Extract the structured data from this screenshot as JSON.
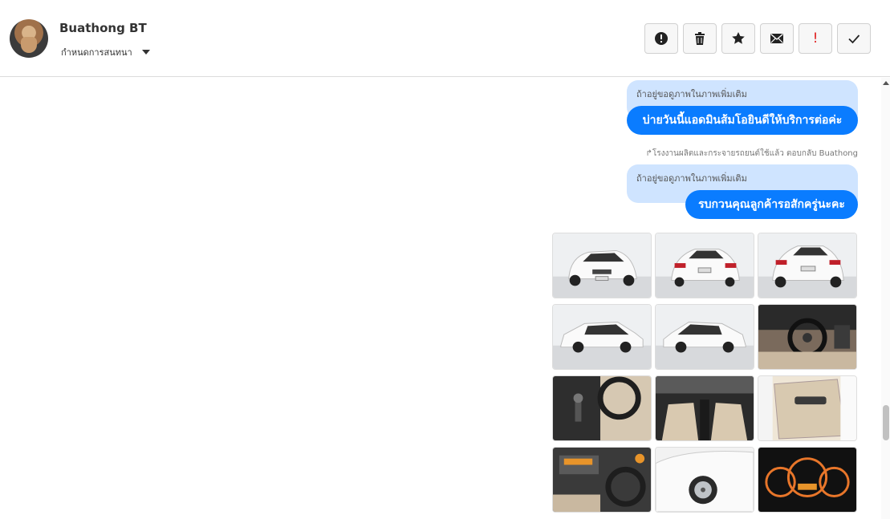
{
  "header": {
    "contact_name": "Buathong BT",
    "conversation_setting": "กำหนดการสนทนา"
  },
  "toolbar": {
    "buttons": [
      {
        "icon": "alert-circle-icon"
      },
      {
        "icon": "trash-icon"
      },
      {
        "icon": "star-icon"
      },
      {
        "icon": "envelope-icon"
      },
      {
        "icon": "exclamation-icon",
        "label": "!",
        "color": "#e02020"
      },
      {
        "icon": "check-icon"
      }
    ]
  },
  "messages": [
    {
      "quoted": "ถ้าอยู่ขอดูภาพในภาพเพิ่มเติม",
      "text": "บ่ายวันนี้แอดมินส้มโอยินดีให้บริการต่อค่ะ"
    },
    {
      "reply_meta": "↱โรงงานผลิตและกระจายรถยนต์ใช้แล้ว ตอบกลับ Buathong",
      "quoted": "ถ้าอยู่ขอดูภาพในภาพเพิ่มเติม",
      "text": "รบกวนคุณลูกค้ารอสักครู่นะคะ"
    }
  ],
  "colors": {
    "bubble": "#0a7cff",
    "quote": "#cfe4ff"
  },
  "photos": [
    "car-front-photo",
    "car-rear-photo",
    "car-rear-angle-photo",
    "car-side-left-photo",
    "car-side-right-photo",
    "dashboard-photo",
    "gear-shift-photo",
    "front-seats-photo",
    "door-panel-photo",
    "center-console-photo",
    "wheel-closeup-photo",
    "gauge-cluster-photo"
  ]
}
